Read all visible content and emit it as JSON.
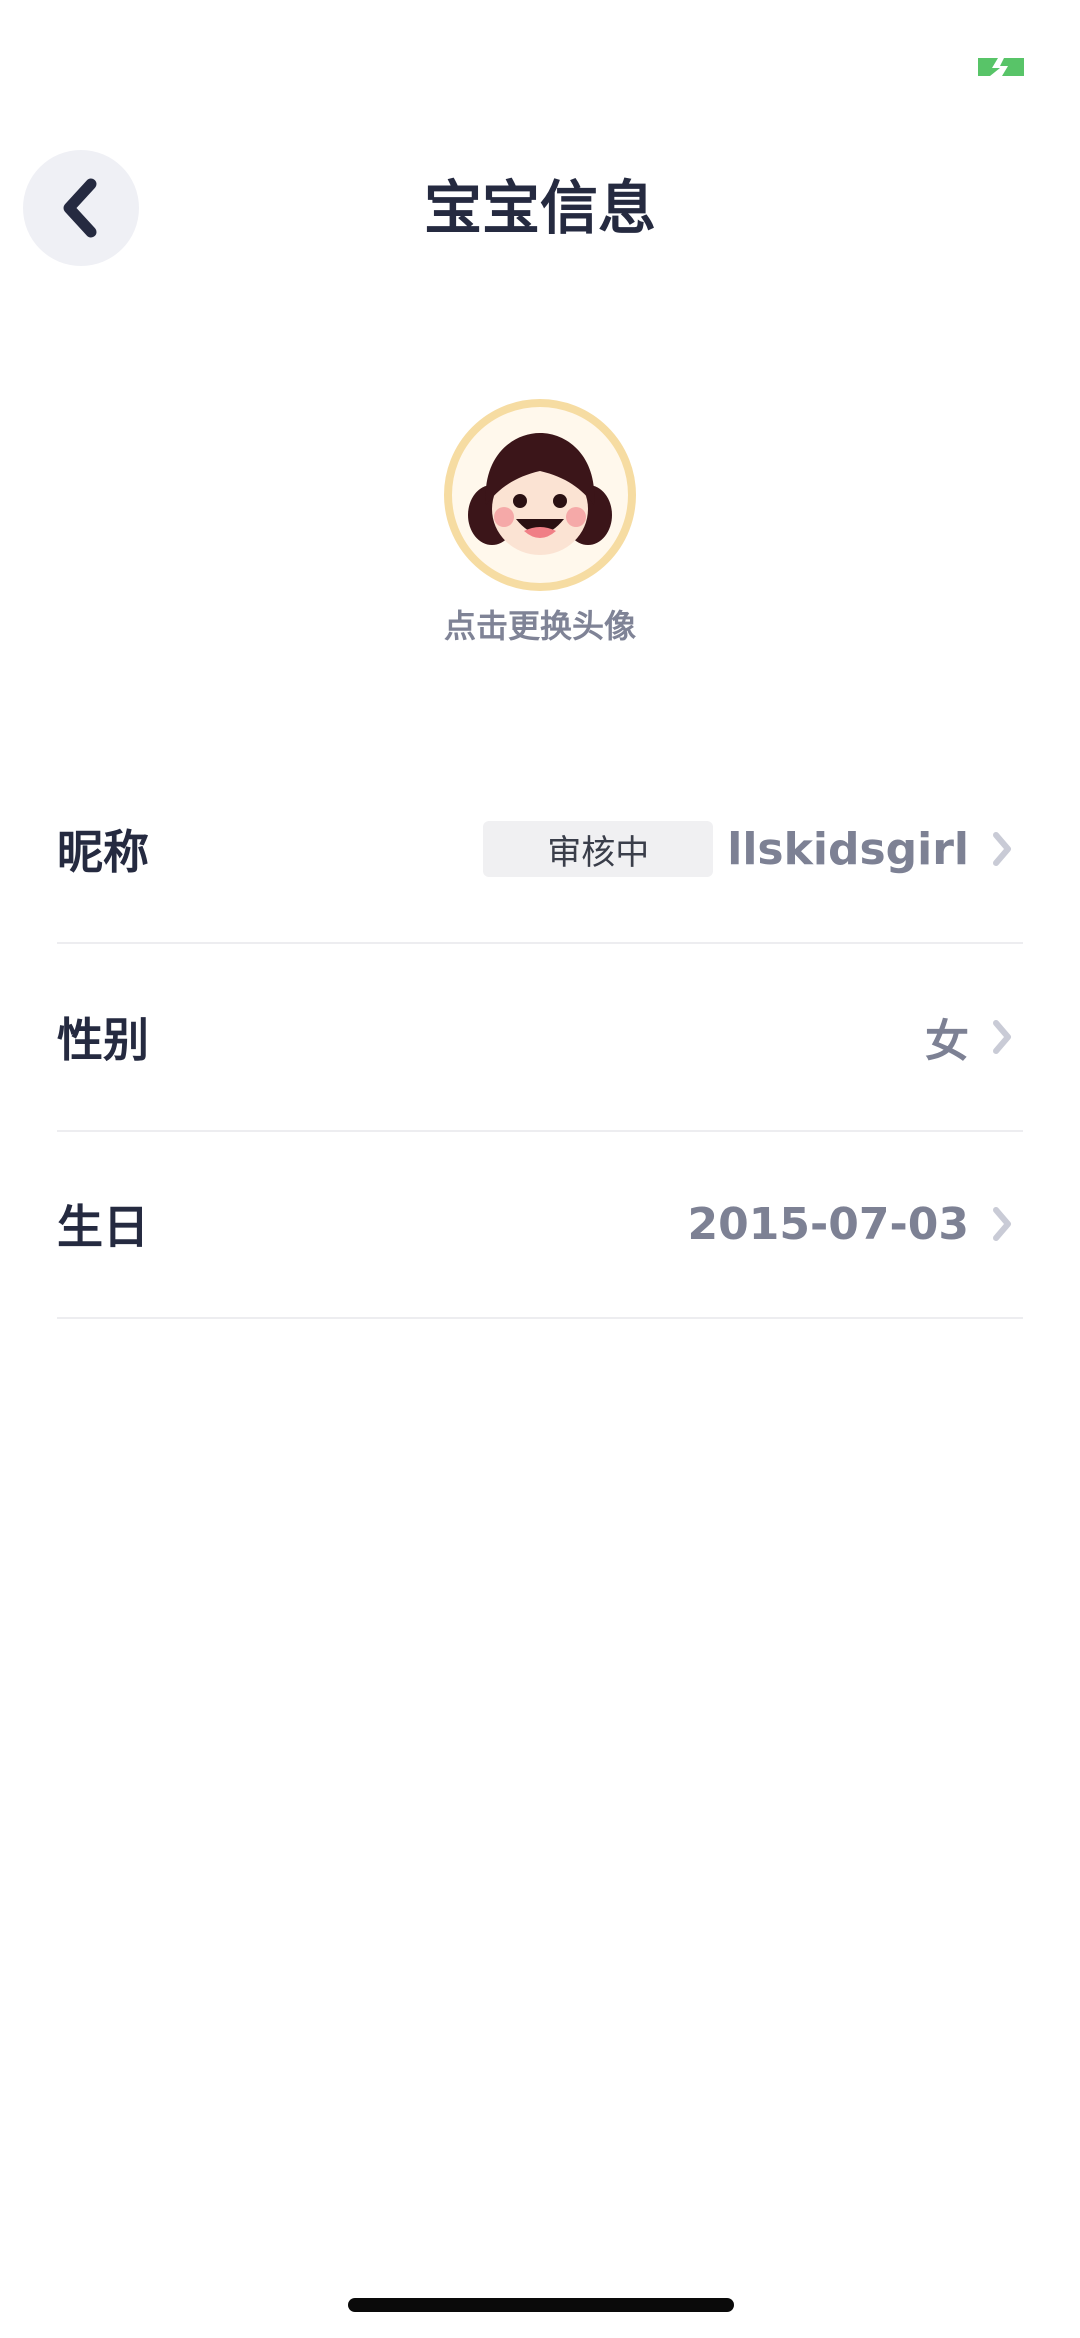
{
  "header": {
    "title": "宝宝信息",
    "back_icon": "chevron-left-icon"
  },
  "avatar": {
    "caption": "点击更换头像",
    "icon": "girl-avatar-icon"
  },
  "rows": [
    {
      "label": "昵称",
      "value": "llskidsgirl",
      "badge": "审核中"
    },
    {
      "label": "性别",
      "value": "女"
    },
    {
      "label": "生日",
      "value": "2015-07-03"
    }
  ],
  "colors": {
    "accent_green": "#4cc46a",
    "avatar_ring": "#f6dca2"
  }
}
